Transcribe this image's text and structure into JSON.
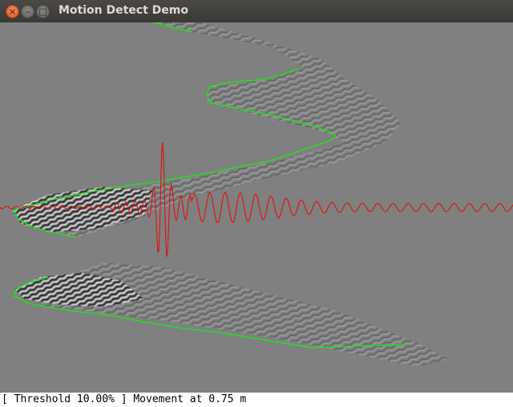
{
  "window": {
    "title": "Motion Detect Demo",
    "close_glyph": "×",
    "minimize_glyph": "–",
    "maximize_glyph": "□"
  },
  "colors": {
    "background_gray": "#808080",
    "envelope_green": "#22dd22",
    "signal_red": "#e01010",
    "status_bg": "#ffffff",
    "accent_close": "#e2561f"
  },
  "visualization": {
    "threshold_percent": 10.0,
    "movement_distance_m": 0.75
  },
  "status": {
    "text": "[ Threshold 10.00% ] Movement at 0.75 m"
  }
}
